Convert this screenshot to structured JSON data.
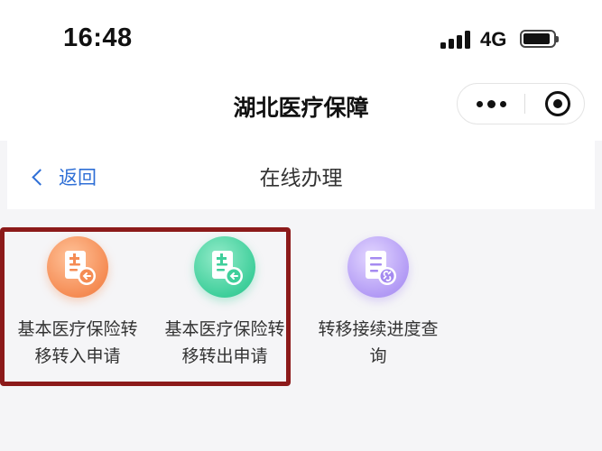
{
  "status_bar": {
    "time": "16:48",
    "network": "4G"
  },
  "mini_program": {
    "title": "湖北医疗保障"
  },
  "page_nav": {
    "back_label": "返回",
    "title": "在线办理"
  },
  "services": [
    {
      "line1": "基本医疗保险转",
      "line2": "移转入申请",
      "icon": "document-plus-arrow-in-icon",
      "color": "#f58c54"
    },
    {
      "line1": "基本医疗保险转",
      "line2": "移转出申请",
      "icon": "document-plus-arrow-out-icon",
      "color": "#3fcf9b"
    },
    {
      "line1": "转移接续进度查",
      "line2": "询",
      "icon": "document-link-icon",
      "color": "#a58af0"
    }
  ]
}
